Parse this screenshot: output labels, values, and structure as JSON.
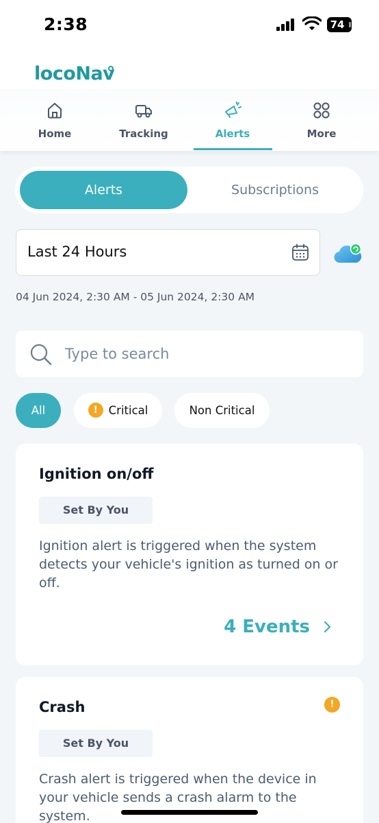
{
  "status": {
    "time": "2:38",
    "battery": "74"
  },
  "app": {
    "logo": "locoNav"
  },
  "nav": {
    "items": [
      {
        "label": "Home",
        "icon": "home-icon"
      },
      {
        "label": "Tracking",
        "icon": "truck-icon"
      },
      {
        "label": "Alerts",
        "icon": "megaphone-icon",
        "active": true
      },
      {
        "label": "More",
        "icon": "grid-icon"
      }
    ]
  },
  "tabs": {
    "active": "Alerts",
    "inactive": "Subscriptions"
  },
  "filter": {
    "range_label": "Last 24 Hours",
    "range_text": "04 Jun 2024, 2:30 AM - 05 Jun 2024, 2:30 AM"
  },
  "search": {
    "placeholder": "Type to search"
  },
  "chips": {
    "all": "All",
    "critical": "Critical",
    "critical_mark": "!",
    "non_critical": "Non Critical"
  },
  "cards": [
    {
      "title": "Ignition on/off",
      "badge": "Set By You",
      "description": "Ignition alert is triggered when the system detects your vehicle's ignition as turned on or off.",
      "events": "4 Events"
    },
    {
      "title": "Crash",
      "badge": "Set By You",
      "critical_mark": "!",
      "description": "Crash alert is triggered when the device in your vehicle sends a crash alarm to the system."
    }
  ],
  "colors": {
    "accent": "#3bafbd",
    "warning": "#f5a623",
    "background": "#f3f6f9"
  }
}
